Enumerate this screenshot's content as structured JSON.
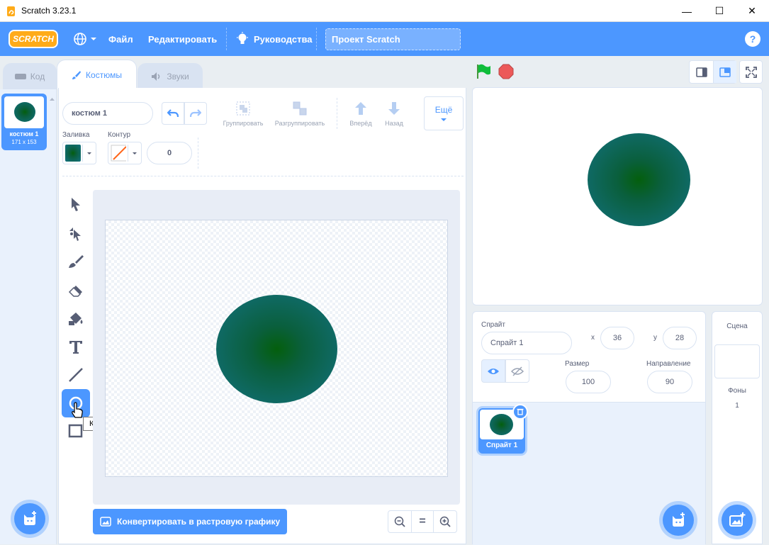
{
  "window": {
    "title": "Scratch 3.23.1",
    "minimize": "—",
    "maximize": "☐",
    "close": "✕"
  },
  "menubar": {
    "logo": "SCRATCH",
    "file": "Файл",
    "edit": "Редактировать",
    "tutorials": "Руководства",
    "project_title": "Проект Scratch",
    "help": "?"
  },
  "tabs": {
    "code": "Код",
    "costumes": "Костюмы",
    "sounds": "Звуки"
  },
  "costume_list": [
    {
      "index": "1",
      "name": "костюм 1",
      "size": "171 x 153"
    }
  ],
  "editor": {
    "costume_name": "костюм 1",
    "group": "Группировать",
    "ungroup": "Разгруппировать",
    "forward": "Вперёд",
    "backward": "Назад",
    "more": "Ещё",
    "fill_label": "Заливка",
    "outline_label": "Контур",
    "outline_width": "0",
    "convert": "Конвертировать в растровую графику",
    "tooltip": "Круг",
    "zoom_reset": "="
  },
  "sprite_info": {
    "sprite_label": "Спрайт",
    "sprite_name": "Спрайт 1",
    "x_label": "x",
    "x_value": "36",
    "y_label": "y",
    "y_value": "28",
    "size_label": "Размер",
    "size_value": "100",
    "direction_label": "Направление",
    "direction_value": "90"
  },
  "sprites": [
    {
      "name": "Спрайт 1"
    }
  ],
  "stage_panel": {
    "title": "Сцена",
    "backdrops_label": "Фоны",
    "backdrops_count": "1"
  },
  "colors": {
    "accent": "#4c97ff",
    "fill_center": "#045f0d",
    "fill_edge": "#137180",
    "go": "#0fbd3b",
    "stop": "#ec5959"
  }
}
